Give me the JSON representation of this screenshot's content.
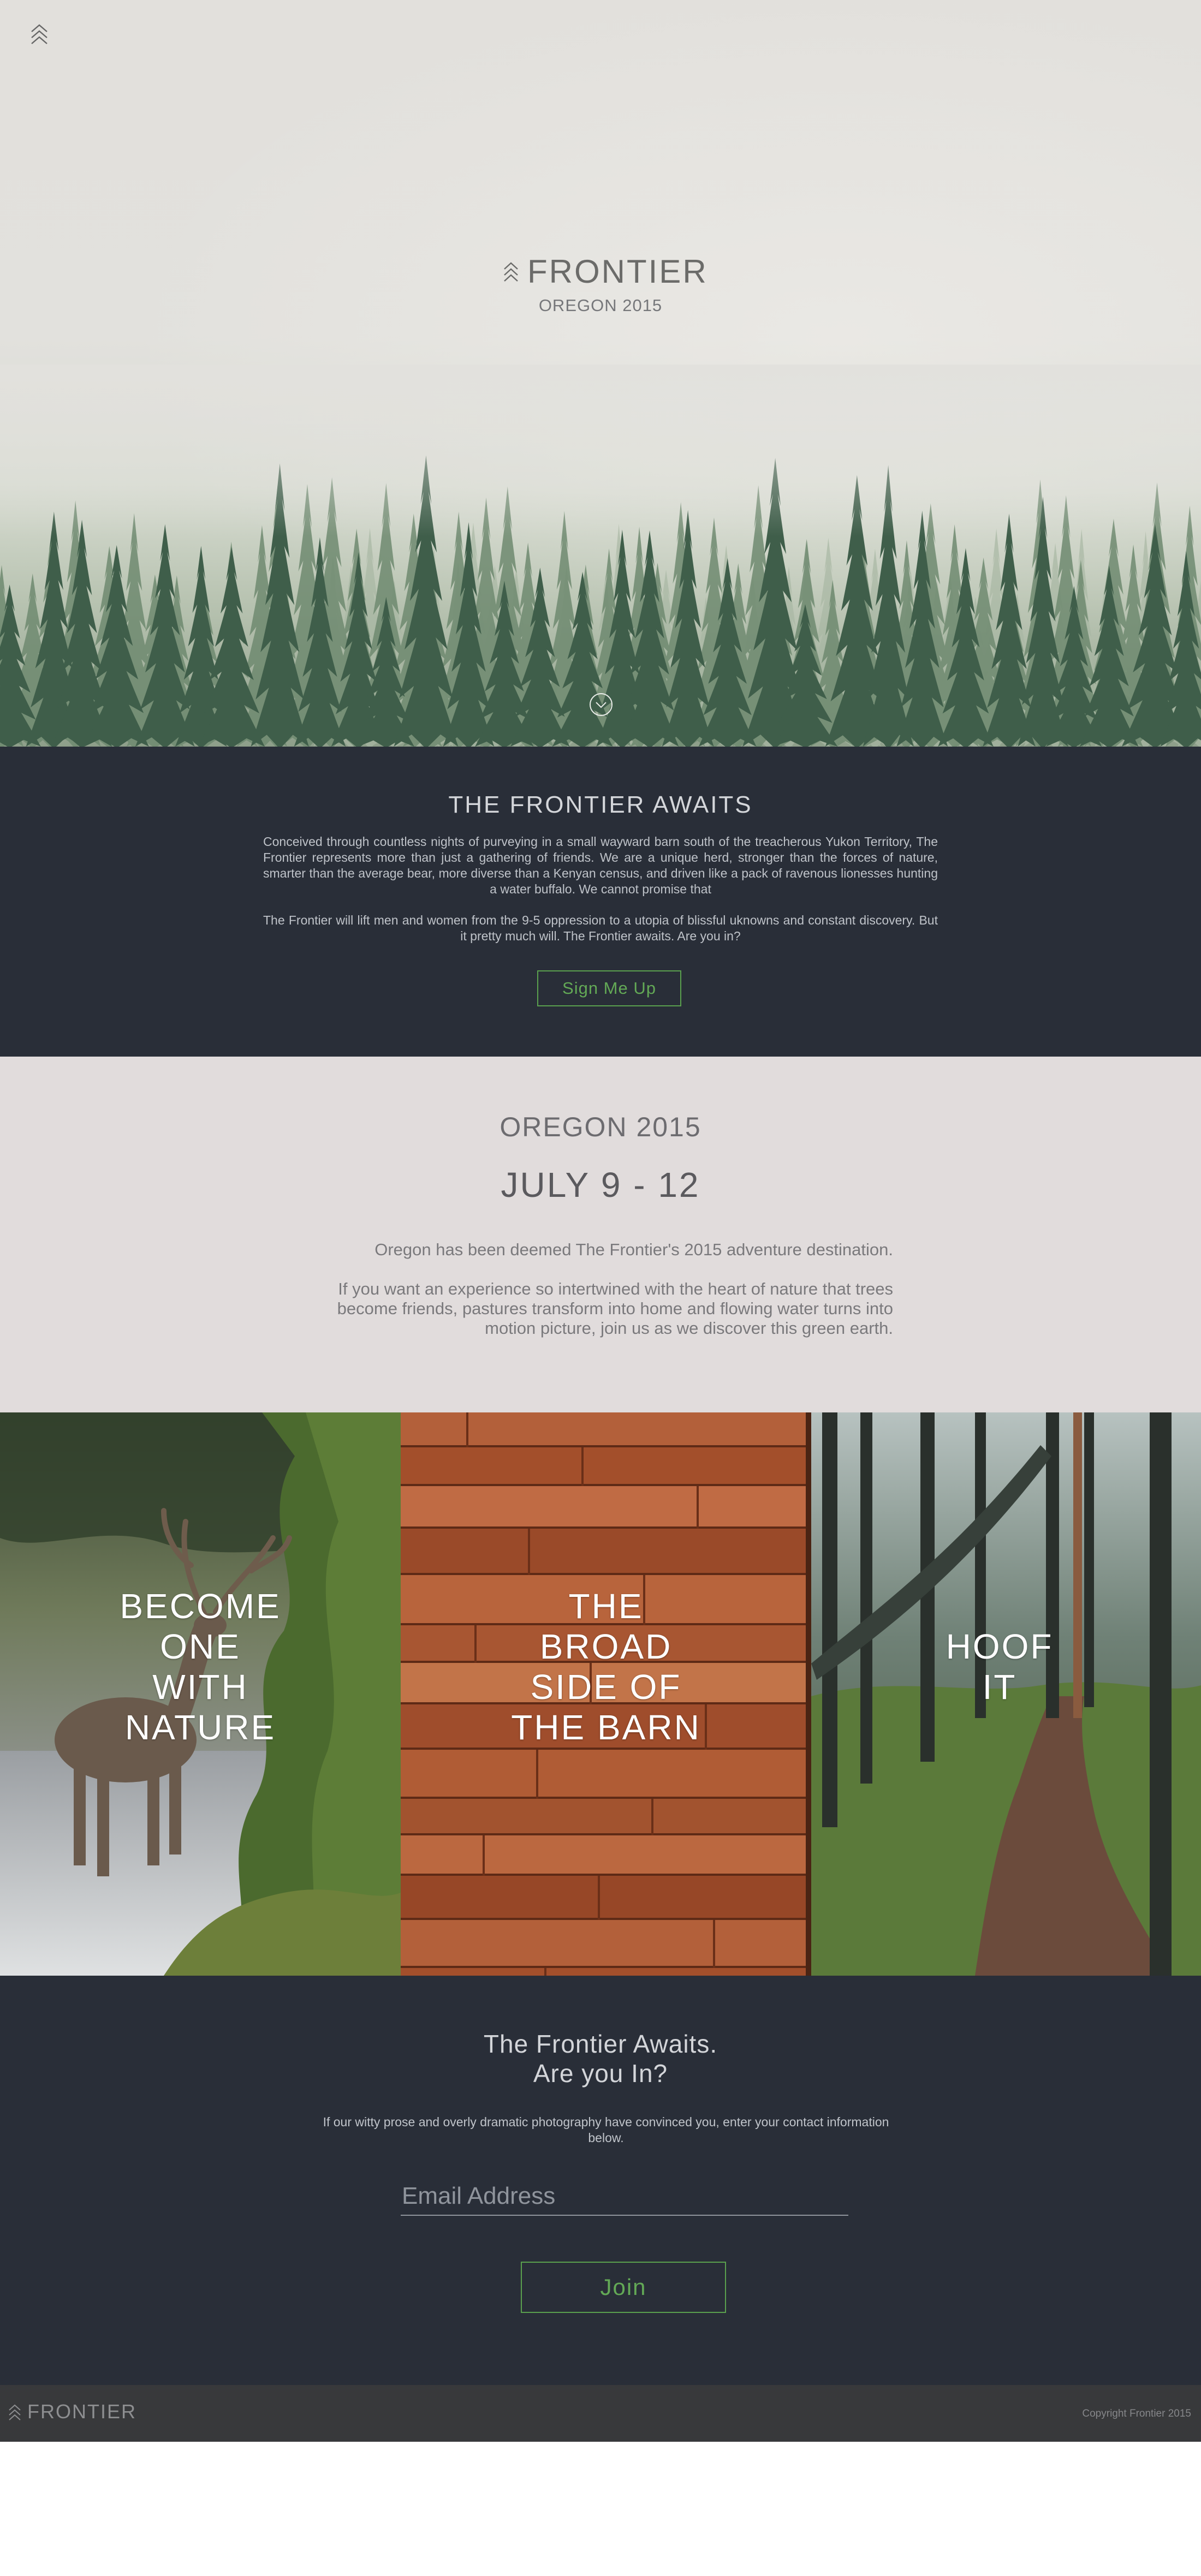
{
  "hero": {
    "title": "FRONTIER",
    "subtitle": "OREGON 2015"
  },
  "awaits": {
    "heading": "THE FRONTIER AWAITS",
    "paragraph1": "Conceived through countless nights of purveying in a small wayward barn south of the treacherous Yukon Territory, The Frontier represents more than just a gathering of friends. We are a unique herd, stronger than the forces of nature, smarter than the average bear, more diverse than a Kenyan census, and driven like a pack of ravenous lionesses hunting a water buffalo. We cannot promise that",
    "paragraph2": "The Frontier will lift men and women from the 9-5 oppression to a utopia of blissful uknowns and constant discovery. But it pretty much will. The Frontier awaits. Are you in?",
    "button_label": "Sign Me Up"
  },
  "oregon": {
    "heading": "OREGON 2015",
    "dates": "JULY 9 - 12",
    "paragraph1": "Oregon has been deemed The Frontier's 2015 adventure destination.",
    "paragraph2": "If you want an experience so intertwined with the heart of nature that trees become friends, pastures transform into home and flowing water turns into motion picture, join us as we discover this green earth."
  },
  "tiles": [
    {
      "lines": [
        "BECOME",
        "ONE",
        "WITH",
        "NATURE"
      ]
    },
    {
      "lines": [
        "THE",
        "BROAD",
        "SIDE OF",
        "THE BARN"
      ]
    },
    {
      "lines": [
        "HOOF",
        "IT"
      ]
    }
  ],
  "join": {
    "heading_line1": "The Frontier Awaits.",
    "heading_line2": "Are you In?",
    "paragraph": "If our witty prose and overly dramatic photography have convinced you, enter your contact information below.",
    "email_placeholder": "Email Address",
    "button_label": "Join"
  },
  "footer": {
    "title": "FRONTIER",
    "copyright": "Copyright Frontier 2015"
  },
  "icons": {
    "logo": "double-chevron-up-icon",
    "scroll": "circle-chevron-down-icon"
  },
  "colors": {
    "dark_section": "#292e38",
    "accent_green": "#5aa04e",
    "light_section": "#e1dcdc",
    "footer": "#38393b"
  }
}
